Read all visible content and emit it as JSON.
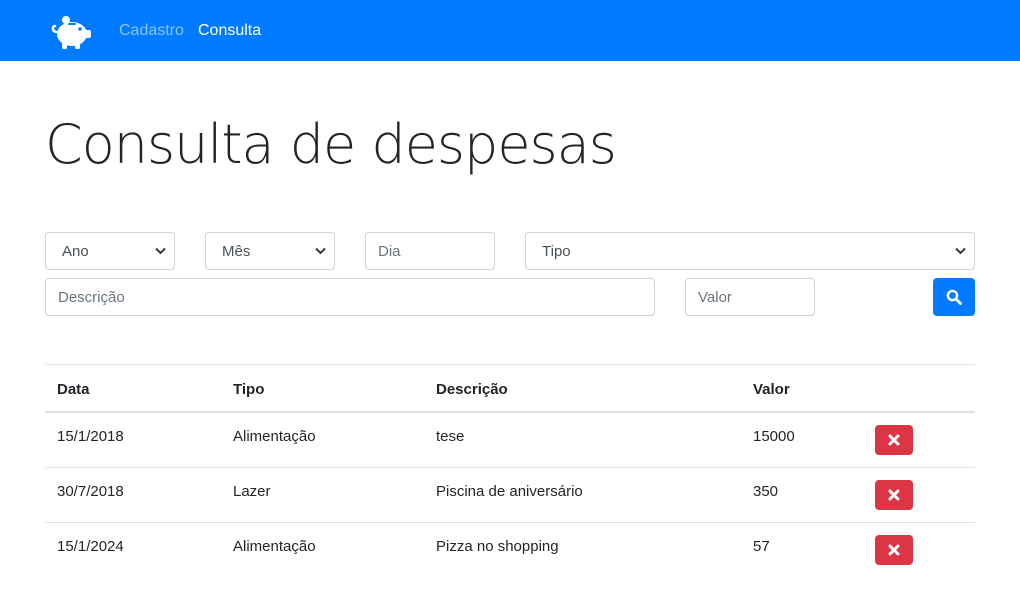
{
  "navbar": {
    "brand_icon": "piggy-bank-icon",
    "links": [
      {
        "label": "Cadastro",
        "active": false
      },
      {
        "label": "Consulta",
        "active": true
      }
    ],
    "color": "#007bff"
  },
  "page": {
    "title": "Consulta de despesas"
  },
  "filters": {
    "ano": {
      "selected": "Ano"
    },
    "mes": {
      "selected": "Mês"
    },
    "dia": {
      "placeholder": "Dia",
      "value": ""
    },
    "tipo": {
      "selected": "Tipo"
    },
    "descricao": {
      "placeholder": "Descrição",
      "value": ""
    },
    "valor": {
      "placeholder": "Valor",
      "value": ""
    },
    "search_icon": "search-icon"
  },
  "table": {
    "headers": [
      "Data",
      "Tipo",
      "Descrição",
      "Valor"
    ],
    "rows": [
      {
        "data": "15/1/2018",
        "tipo": "Alimentação",
        "descricao": "tese",
        "valor": "15000"
      },
      {
        "data": "30/7/2018",
        "tipo": "Lazer",
        "descricao": "Piscina de aniversário",
        "valor": "350"
      },
      {
        "data": "15/1/2024",
        "tipo": "Alimentação",
        "descricao": "Pizza no shopping",
        "valor": "57"
      }
    ],
    "delete_icon": "times-icon",
    "delete_color": "#dc3545"
  }
}
